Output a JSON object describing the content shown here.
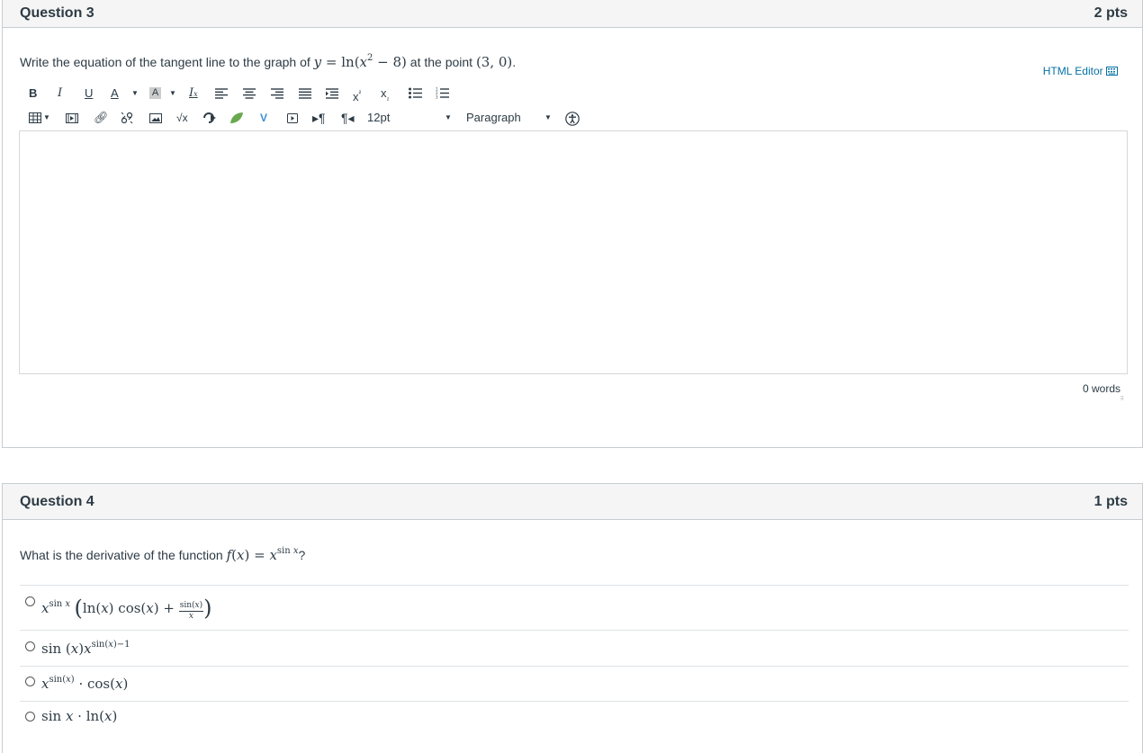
{
  "q3": {
    "title": "Question 3",
    "points": "2 pts",
    "text_before": "Write the equation of the tangent line to the graph of ",
    "math_eq": "y = ln(x² − 8)",
    "text_mid": " at the point ",
    "math_point": "(3, 0)",
    "text_end": ".",
    "html_editor_label": "HTML Editor",
    "font_size_value": "12pt",
    "block_format_value": "Paragraph",
    "word_count": "0 words"
  },
  "toolbar": {
    "row1": [
      "bold-icon",
      "italic-icon",
      "underline-icon",
      "text-color-icon",
      "background-color-icon",
      "clear-formatting-icon",
      "align-left-icon",
      "align-center-icon",
      "align-right-icon",
      "align-justify-icon",
      "indent-icon",
      "superscript-icon",
      "subscript-icon",
      "bullet-list-icon",
      "numbered-list-icon"
    ],
    "row2": [
      "table-icon",
      "media-icon",
      "link-icon",
      "unlink-icon",
      "image-icon",
      "equation-icon",
      "embed-icon",
      "leaf-icon",
      "chevron-v-icon",
      "media-play-icon",
      "ltr-icon",
      "rtl-icon",
      "accessibility-icon"
    ]
  },
  "q4": {
    "title": "Question 4",
    "points": "1 pts",
    "text_before": "What is the derivative of the function ",
    "math_func": "f(x) = x^(sin x)",
    "text_end": "?",
    "options": [
      "x^(sin x) (ln(x) cos(x) + sin(x)/x)",
      "sin (x) x^(sin(x)−1)",
      "x^(sin(x)) · cos(x)",
      "sin x · ln(x)"
    ]
  },
  "colors": {
    "header_bg": "#f5f5f5",
    "border": "#c7cdd1",
    "link": "#0770a3",
    "text": "#2d3b45",
    "leaf": "#6aa84f",
    "v_icon": "#3d8fd6"
  }
}
